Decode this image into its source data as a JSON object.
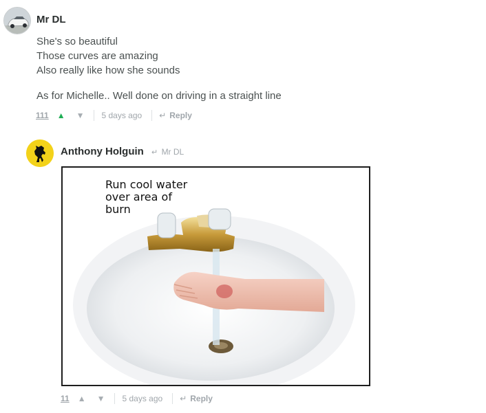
{
  "comments": [
    {
      "author": "Mr DL",
      "avatar_icon": "car-avatar",
      "body": [
        "She's so beautiful",
        "Those curves are amazing",
        "Also really like how she sounds",
        "As for Michelle.. Well done on driving in a straight line"
      ],
      "votes": "111",
      "upvoted": true,
      "time": "5 days ago",
      "reply_label": "Reply"
    },
    {
      "author": "Anthony Holguin",
      "avatar_icon": "prancing-horse-avatar",
      "reply_to": "Mr DL",
      "image_caption": [
        "Run cool water",
        "over area of",
        "burn"
      ],
      "votes": "11",
      "upvoted": false,
      "time": "5 days ago",
      "reply_label": "Reply"
    }
  ],
  "colors": {
    "upvote_active": "#1fae54",
    "meta": "#a0a6ab",
    "author": "#2a2e2e",
    "avatar_yellow": "#f3d21a"
  },
  "icons": {
    "upvote": "▲",
    "downvote": "▼",
    "reply_arrow": "↵"
  }
}
